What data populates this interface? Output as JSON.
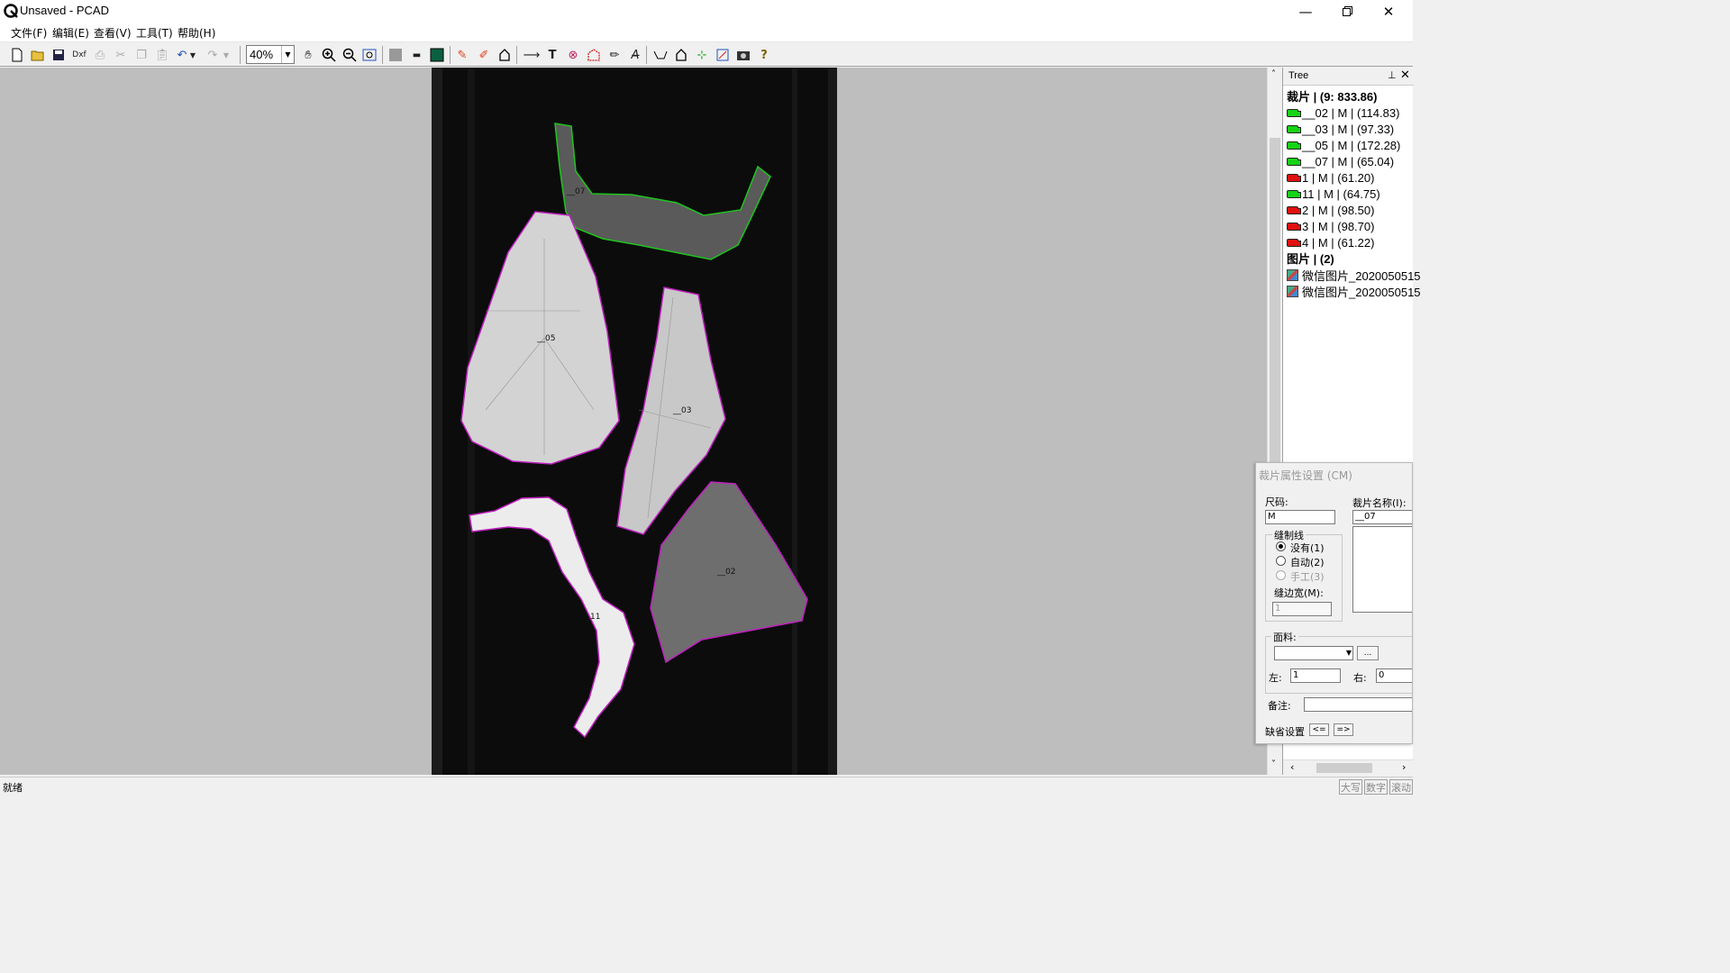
{
  "window": {
    "title": "Unsaved - PCAD"
  },
  "menu": [
    "文件(F)",
    "编辑(E)",
    "查看(V)",
    "工具(T)",
    "帮助(H)"
  ],
  "toolbar": {
    "zoom": "40%"
  },
  "canvas": {
    "pieces": [
      {
        "label": "__07",
        "outline": "#1fc41f"
      },
      {
        "label": "__05",
        "outline": "#c020c0"
      },
      {
        "label": "__03",
        "outline": "#c020c0"
      },
      {
        "label": "__02",
        "outline": "#c020c0"
      },
      {
        "label": "11",
        "outline": "#c020c0"
      }
    ]
  },
  "tree": {
    "title": "Tree",
    "group_pieces": "裁片 | (9: 833.86)",
    "pieces": [
      {
        "label": "__02 | M | (114.83)",
        "status": "green"
      },
      {
        "label": "__03 | M | (97.33)",
        "status": "green"
      },
      {
        "label": "__05 | M | (172.28)",
        "status": "green"
      },
      {
        "label": "__07 | M | (65.04)",
        "status": "green"
      },
      {
        "label": "1 | M | (61.20)",
        "status": "red"
      },
      {
        "label": "11 | M | (64.75)",
        "status": "green"
      },
      {
        "label": "2 | M | (98.50)",
        "status": "red"
      },
      {
        "label": "3 | M | (98.70)",
        "status": "red"
      },
      {
        "label": "4 | M | (61.22)",
        "status": "red"
      }
    ],
    "group_images": "图片 | (2)",
    "images": [
      "微信图片_2020050515",
      "微信图片_2020050515"
    ]
  },
  "colors": {
    "green": "#16d316",
    "red": "#e01010"
  },
  "property_dialog": {
    "title": "裁片属性设置 (CM)",
    "size_label": "尺码:",
    "size_value": "M",
    "name_label": "裁片名称(I):",
    "name_value": "__07",
    "seam_group": "缝制线",
    "seam_none": "没有(1)",
    "seam_auto": "自动(2)",
    "seam_manual": "手工(3)",
    "seam_width_label": "缝边宽(M):",
    "seam_width_value": "1",
    "fabric_label": "面料:",
    "browse_label": "...",
    "left_label": "左:",
    "left_value": "1",
    "right_label": "右:",
    "right_value": "0",
    "note_label": "备注:",
    "default_label": "缺省设置",
    "prev_label": "<=",
    "next_label": "=>"
  },
  "status": {
    "text": "就绪",
    "caps": "大写",
    "num": "数字",
    "scroll": "滚动"
  }
}
